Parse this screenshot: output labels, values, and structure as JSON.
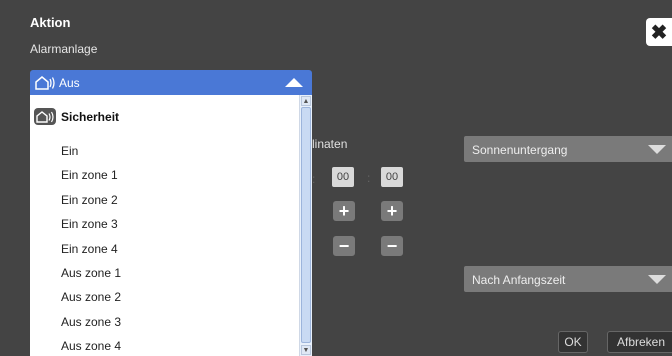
{
  "dialog": {
    "title": "Aktion",
    "subtitle": "Alarmanlage",
    "close_label": "✖"
  },
  "select": {
    "value": "Aus",
    "icon": "alarm-house-icon"
  },
  "dropdown": {
    "group_label": "Sicherheit",
    "group_icon": "alarm-house-icon",
    "items": [
      "Ein",
      "Ein zone 1",
      "Ein zone 2",
      "Ein zone 3",
      "Ein zone 4",
      "Aus zone 1",
      "Aus zone 2",
      "Aus zone 3",
      "Aus zone 4"
    ]
  },
  "background": {
    "coords_label": "linaten",
    "time_hours": "00",
    "time_minutes": "00",
    "time_separator": ":",
    "plus_label": "+",
    "minus_label": "−",
    "sun_select": "Sonnenuntergang",
    "start_select": "Nach Anfangszeit"
  },
  "buttons": {
    "ok": "OK",
    "cancel": "Afbreken"
  }
}
